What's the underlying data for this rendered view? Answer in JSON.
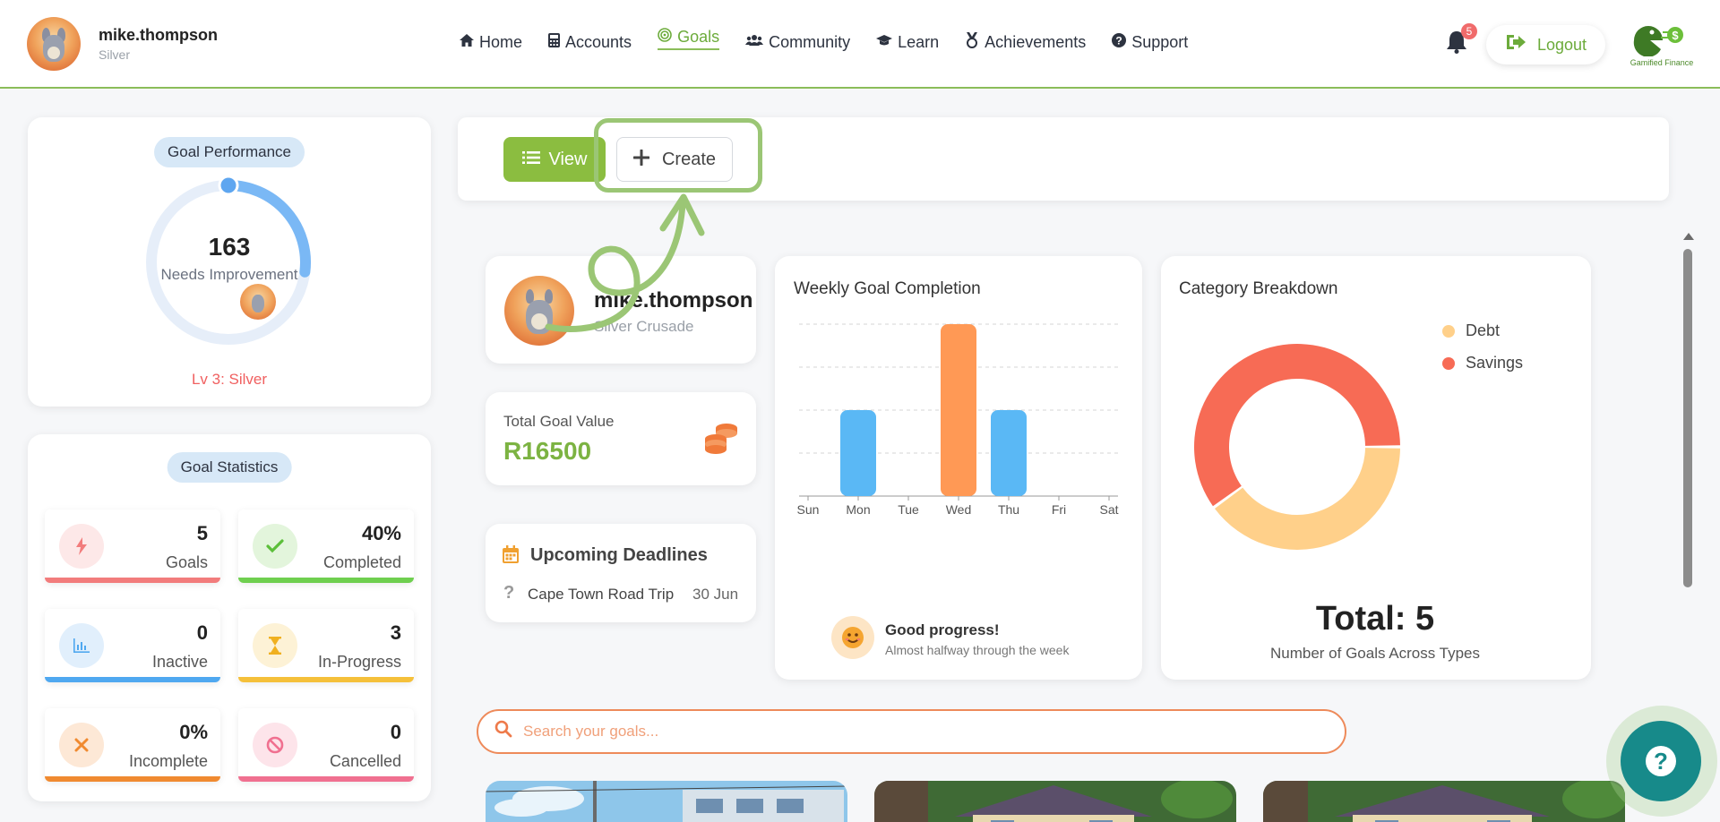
{
  "header": {
    "user": {
      "name": "mike.thompson",
      "rank": "Silver"
    },
    "nav": [
      {
        "label": "Home",
        "icon": "home-icon"
      },
      {
        "label": "Accounts",
        "icon": "calculator-icon"
      },
      {
        "label": "Goals",
        "icon": "target-icon",
        "active": true
      },
      {
        "label": "Community",
        "icon": "users-icon"
      },
      {
        "label": "Learn",
        "icon": "graduation-cap-icon"
      },
      {
        "label": "Achievements",
        "icon": "medal-icon"
      },
      {
        "label": "Support",
        "icon": "question-circle-icon"
      }
    ],
    "notifications_count": "5",
    "logout_label": "Logout",
    "brand_text": "Gamified Finance"
  },
  "performance": {
    "title": "Goal Performance",
    "score": "163",
    "status": "Needs Improvement",
    "level": "Lv 3: Silver",
    "progress_fraction": 0.27,
    "ring_color": "#7ab8f5"
  },
  "statistics": {
    "title": "Goal Statistics",
    "items": [
      {
        "value": "5",
        "label": "Goals",
        "icon": "bolt-icon",
        "color": "#f27c7c"
      },
      {
        "value": "40%",
        "label": "Completed",
        "icon": "check-icon",
        "color": "#6fcf4f"
      },
      {
        "value": "0",
        "label": "Inactive",
        "icon": "bar-chart-icon",
        "color": "#4fa8f0"
      },
      {
        "value": "3",
        "label": "In-Progress",
        "icon": "hourglass-icon",
        "color": "#f5c03a"
      },
      {
        "value": "0%",
        "label": "Incomplete",
        "icon": "x-icon",
        "color": "#f08a30"
      },
      {
        "value": "0",
        "label": "Cancelled",
        "icon": "ban-icon",
        "color": "#f07090"
      }
    ]
  },
  "toolbar": {
    "view_label": "View",
    "create_label": "Create"
  },
  "profile": {
    "name": "mike.thompson",
    "title": "Silver Crusade"
  },
  "goal_value": {
    "label": "Total Goal Value",
    "value": "R16500"
  },
  "deadlines": {
    "title": "Upcoming Deadlines",
    "items": [
      {
        "name": "Cape Town Road Trip",
        "date": "30 Jun"
      }
    ]
  },
  "weekly": {
    "title": "Weekly Goal Completion",
    "message_title": "Good progress!",
    "message_sub": "Almost halfway through the week"
  },
  "category": {
    "title": "Category Breakdown",
    "total_label": "Total: 5",
    "total_sub": "Number of Goals Across Types"
  },
  "search": {
    "placeholder": "Search your goals..."
  },
  "chart_data": [
    {
      "type": "bar",
      "categories": [
        "Sun",
        "Mon",
        "Tue",
        "Wed",
        "Thu",
        "Fri",
        "Sat"
      ],
      "values": [
        0,
        2,
        0,
        4,
        2,
        0,
        0
      ],
      "colors": [
        "#5ab8f5",
        "#5ab8f5",
        "#5ab8f5",
        "#ff9955",
        "#5ab8f5",
        "#5ab8f5",
        "#5ab8f5"
      ],
      "ylim": [
        0,
        4
      ],
      "grid": true
    },
    {
      "type": "pie",
      "donut": true,
      "categories": [
        "Debt",
        "Savings"
      ],
      "values": [
        2,
        3
      ],
      "colors": [
        "#ffd08a",
        "#f76b55"
      ],
      "legend": "top-right"
    }
  ]
}
